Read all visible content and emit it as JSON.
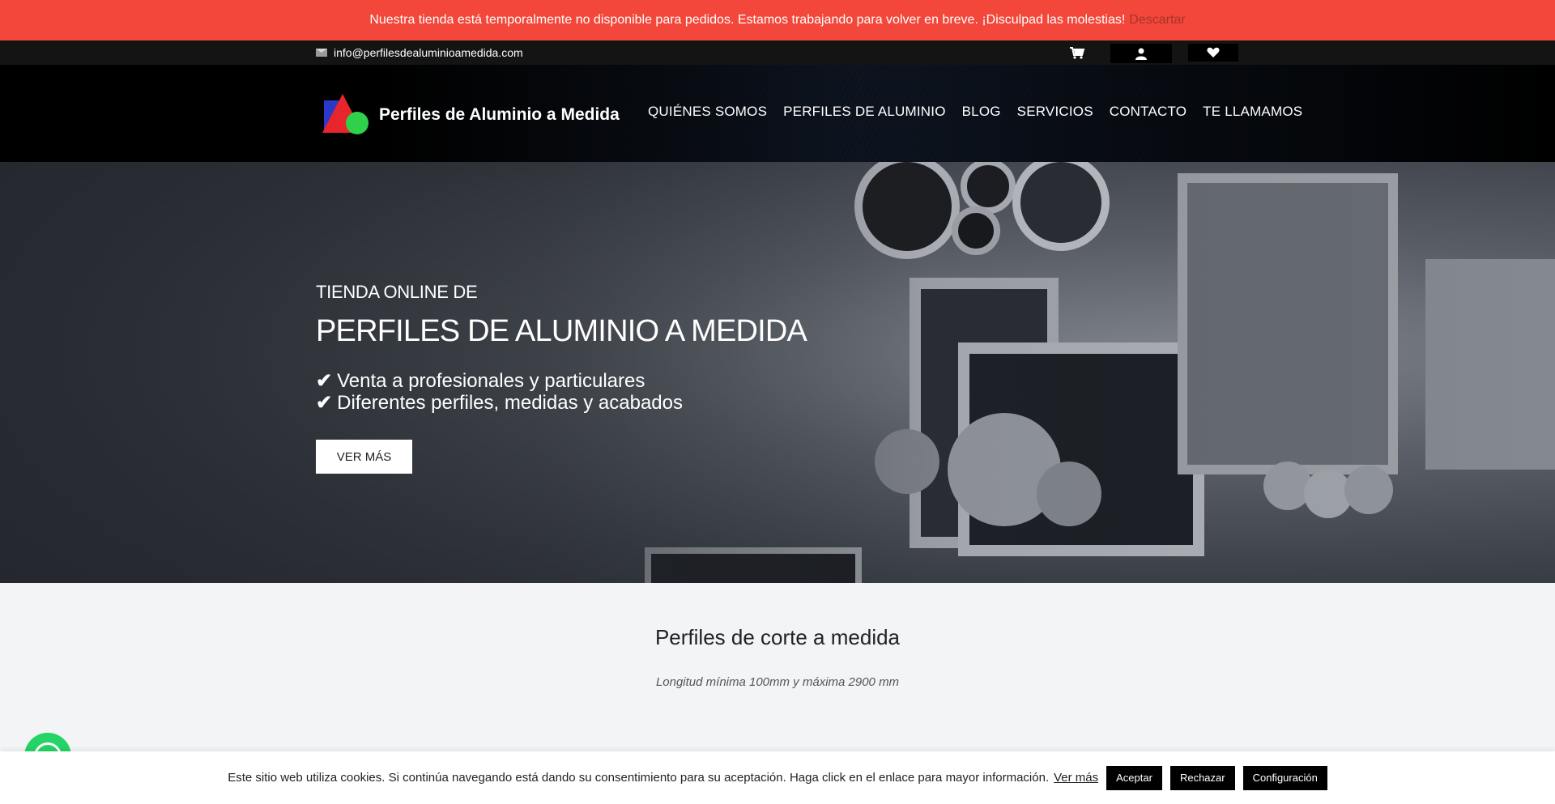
{
  "notice": {
    "text": "Nuestra tienda está temporalmente no disponible para pedidos. Estamos trabajando para volver en breve. ¡Disculpad las molestias!",
    "dismiss": "Descartar"
  },
  "topbar": {
    "email": "info@perfilesdealuminioamedida.com",
    "icons": [
      "envelope-icon",
      "cart-icon",
      "user-icon",
      "heart-icon"
    ]
  },
  "brand": {
    "name": "Perfiles de Aluminio a Medida"
  },
  "nav": {
    "items": [
      {
        "label": "QUIÉNES SOMOS"
      },
      {
        "label": "PERFILES DE ALUMINIO"
      },
      {
        "label": "BLOG"
      },
      {
        "label": "SERVICIOS"
      },
      {
        "label": "CONTACTO"
      },
      {
        "label": "TE LLAMAMOS"
      }
    ]
  },
  "hero": {
    "subtitle": "TIENDA ONLINE DE",
    "title": "PERFILES DE ALUMINIO A MEDIDA",
    "features": [
      {
        "text": "Venta a profesionales y particulares"
      },
      {
        "text": "Diferentes perfiles, medidas y acabados"
      }
    ],
    "button": "VER MÁS"
  },
  "section": {
    "title": "Perfiles de corte a medida",
    "subtitle": "Longitud mínima 100mm y máxima 2900 mm"
  },
  "cookie": {
    "text": "Este sitio web utiliza cookies. Si continúa navegando está dando su consentimiento para su aceptación. Haga click en el enlace para mayor información.",
    "more": "Ver más",
    "accept": "Aceptar",
    "reject": "Rechazar",
    "settings": "Configuración"
  },
  "colors": {
    "notice_bg": "#f2473a",
    "topbar_bg": "#141414",
    "whatsapp": "#25d366"
  }
}
